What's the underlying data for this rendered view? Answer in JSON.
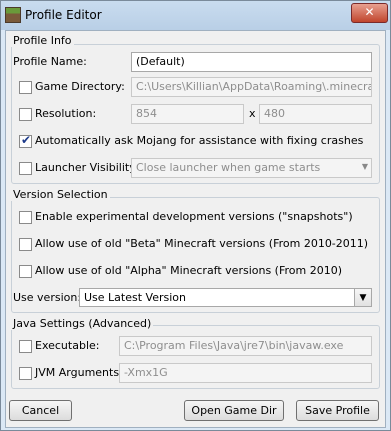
{
  "window": {
    "title": "Profile Editor",
    "close_label": "✕"
  },
  "profile_info": {
    "group_title": "Profile Info",
    "name_label": "Profile Name:",
    "name_value": "(Default)",
    "game_dir_label": "Game Directory:",
    "game_dir_value": "C:\\Users\\Killian\\AppData\\Roaming\\.minecraft",
    "resolution_label": "Resolution:",
    "res_width": "854",
    "res_x": "x",
    "res_height": "480",
    "auto_ask_label": "Automatically ask Mojang for assistance with fixing crashes",
    "auto_ask_checked": true,
    "launcher_vis_label": "Launcher Visibility:",
    "launcher_vis_value": "Close launcher when game starts"
  },
  "version_selection": {
    "group_title": "Version Selection",
    "snapshots_label": "Enable experimental development versions (\"snapshots\")",
    "beta_label": "Allow use of old \"Beta\" Minecraft versions (From 2010-2011)",
    "alpha_label": "Allow use of old \"Alpha\" Minecraft versions (From 2010)",
    "use_version_label": "Use version:",
    "use_version_value": "Use Latest Version"
  },
  "java_settings": {
    "group_title": "Java Settings (Advanced)",
    "executable_label": "Executable:",
    "executable_value": "C:\\Program Files\\Java\\jre7\\bin\\javaw.exe",
    "jvm_label": "JVM Arguments:",
    "jvm_value": "-Xmx1G"
  },
  "buttons": {
    "cancel": "Cancel",
    "open_game_dir": "Open Game Dir",
    "save_profile": "Save Profile"
  },
  "icons": {
    "app": "minecraft-grass-block-icon",
    "check": "✔",
    "dropdown": "▼",
    "combo": "▼"
  }
}
